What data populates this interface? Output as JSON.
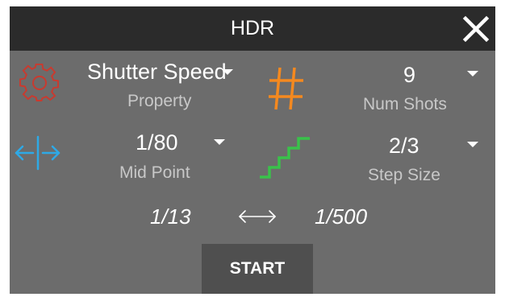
{
  "dialog": {
    "title": "HDR",
    "close_icon": "close-icon"
  },
  "property": {
    "value": "Shutter Speed",
    "caption": "Property",
    "icon": "gear-icon",
    "icon_color": "#c93a2f"
  },
  "num_shots": {
    "value": "9",
    "caption": "Num Shots",
    "icon": "hash-icon",
    "icon_color": "#f5891f"
  },
  "mid_point": {
    "value": "1/80",
    "caption": "Mid Point",
    "icon": "split-arrows-icon",
    "icon_color": "#2ea9e6"
  },
  "step_size": {
    "value": "2/3",
    "caption": "Step Size",
    "icon": "stairs-icon",
    "icon_color": "#39c24a"
  },
  "range": {
    "low": "1/13",
    "high": "1/500",
    "separator_icon": "double-arrow-icon"
  },
  "actions": {
    "start_label": "START"
  }
}
